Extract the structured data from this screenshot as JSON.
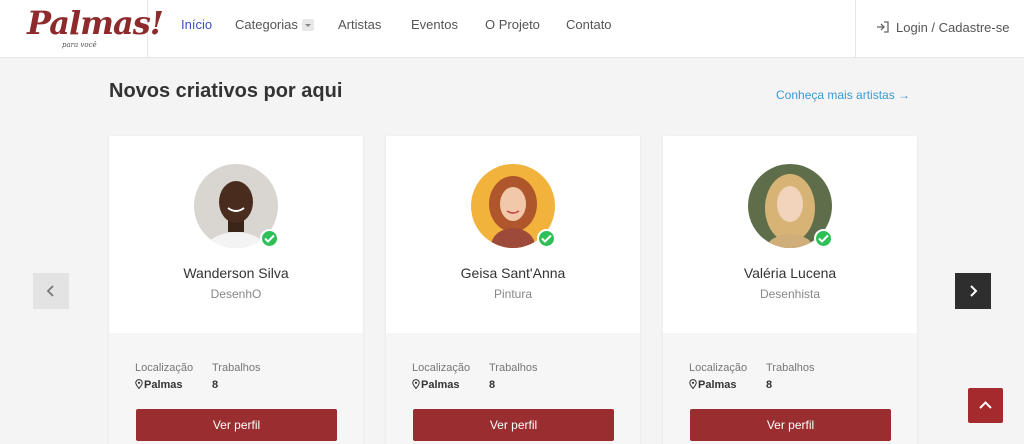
{
  "logo": {
    "text": "Palmas!",
    "tagline": "para você"
  },
  "nav": {
    "items": [
      {
        "label": "Início",
        "active": true
      },
      {
        "label": "Categorias",
        "dropdown": true
      },
      {
        "label": "Artistas"
      },
      {
        "label": "Eventos"
      },
      {
        "label": "O Projeto"
      },
      {
        "label": "Contato"
      }
    ],
    "login": {
      "label": "Login / Cadastre-se",
      "icon": "login-icon"
    }
  },
  "section": {
    "title": "Novos criativos por aqui",
    "more_link": "Conheça mais artistas →"
  },
  "cards": [
    {
      "name": "Wanderson Silva",
      "role": "DesenhO",
      "location_label": "Localização",
      "location": "Palmas",
      "works_label": "Trabalhos",
      "works": "8",
      "button": "Ver perfil",
      "verified": true
    },
    {
      "name": "Geisa Sant'Anna",
      "role": "Pintura",
      "location_label": "Localização",
      "location": "Palmas",
      "works_label": "Trabalhos",
      "works": "8",
      "button": "Ver perfil",
      "verified": true
    },
    {
      "name": "Valéria Lucena",
      "role": "Desenhista",
      "location_label": "Localização",
      "location": "Palmas",
      "works_label": "Trabalhos",
      "works": "8",
      "button": "Ver perfil",
      "verified": true
    }
  ],
  "colors": {
    "brand": "#9a2d2f",
    "nav_active": "#3b4fc6",
    "link": "#3a9bd5",
    "verified": "#2fbf57"
  }
}
